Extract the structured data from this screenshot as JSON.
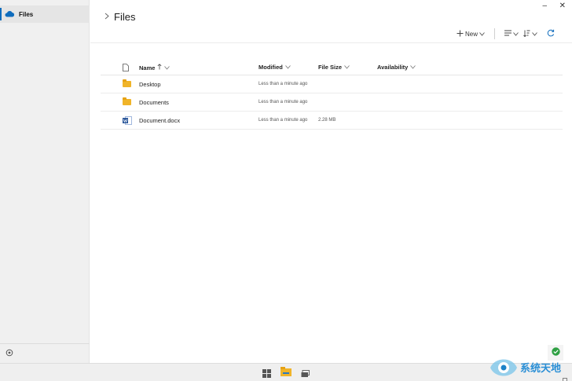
{
  "sidebar": {
    "items": [
      {
        "label": "Files",
        "icon": "onedrive-cloud-icon",
        "selected": true
      }
    ],
    "bottom_icon": "settings-icon"
  },
  "window": {
    "minimize": "–",
    "close": "✕"
  },
  "header": {
    "title": "Files"
  },
  "toolbar": {
    "new_label": "New"
  },
  "table": {
    "columns": [
      {
        "label": "Name",
        "sort": "ascending"
      },
      {
        "label": "Modified"
      },
      {
        "label": "File Size"
      },
      {
        "label": "Availability"
      }
    ],
    "rows": [
      {
        "type": "folder",
        "name": "Desktop",
        "modified": "Less than a minute ago",
        "size": ""
      },
      {
        "type": "folder",
        "name": "Documents",
        "modified": "Less than a minute ago",
        "size": ""
      },
      {
        "type": "word-document",
        "name": "Document.docx",
        "modified": "Less than a minute ago",
        "size": "2.28 MB"
      }
    ]
  },
  "watermark": {
    "text": "系统天地"
  },
  "colors": {
    "accent": "#0f6cbd",
    "folder": "#f0b429",
    "word": "#2b579a",
    "sync_ok": "#2ea043"
  }
}
